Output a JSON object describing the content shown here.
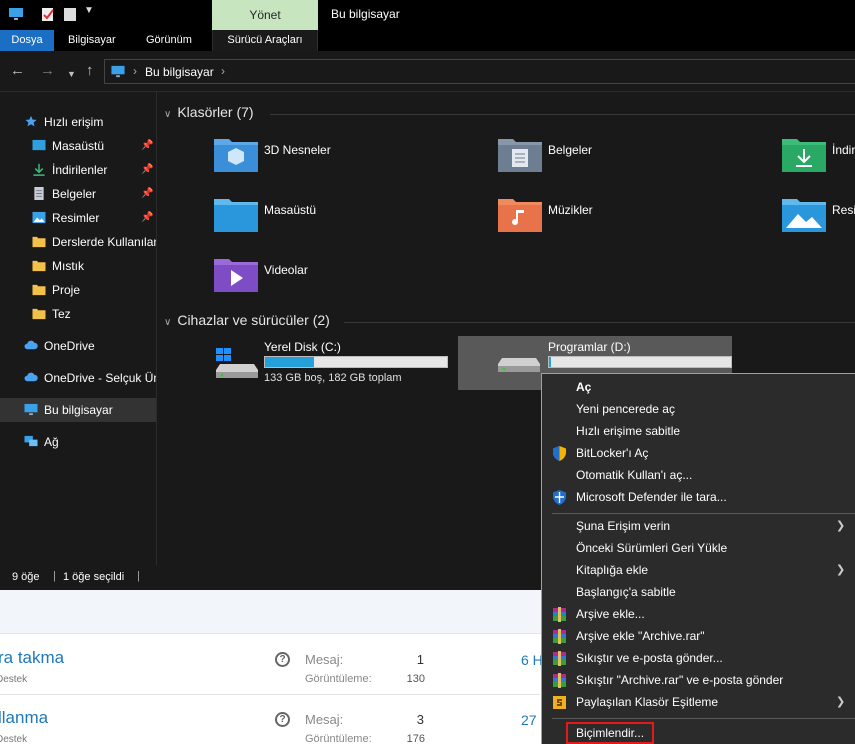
{
  "window": {
    "title": "Bu bilgisayar",
    "context_tab": "Yönet",
    "context_subtab": "Sürücü Araçları"
  },
  "ribbon": {
    "tabs": [
      "Dosya",
      "Bilgisayar",
      "Görünüm"
    ]
  },
  "address": {
    "path": "Bu bilgisayar",
    "icon": "computer-icon"
  },
  "sidebar": {
    "items": [
      {
        "label": "Hızlı erişim",
        "icon": "star-icon",
        "pinned": false
      },
      {
        "label": "Masaüstü",
        "icon": "desktop-folder-icon",
        "pinned": true
      },
      {
        "label": "İndirilenler",
        "icon": "download-icon",
        "pinned": true
      },
      {
        "label": "Belgeler",
        "icon": "documents-icon",
        "pinned": true
      },
      {
        "label": "Resimler",
        "icon": "pictures-icon",
        "pinned": true
      },
      {
        "label": "Derslerde Kullanılan",
        "icon": "folder-icon",
        "pinned": false
      },
      {
        "label": "Mıstık",
        "icon": "folder-icon",
        "pinned": false
      },
      {
        "label": "Proje",
        "icon": "folder-icon",
        "pinned": false
      },
      {
        "label": "Tez",
        "icon": "folder-icon",
        "pinned": false
      },
      {
        "label": "OneDrive",
        "icon": "cloud-icon",
        "pinned": false
      },
      {
        "label": "OneDrive - Selçuk Ün",
        "icon": "cloud-icon",
        "pinned": false
      },
      {
        "label": "Bu bilgisayar",
        "icon": "computer-icon",
        "pinned": false,
        "selected": true
      },
      {
        "label": "Ağ",
        "icon": "network-icon",
        "pinned": false
      }
    ]
  },
  "content": {
    "folders_header": "Klasörler (7)",
    "folders": [
      {
        "label": "3D Nesneler",
        "icon": "3d-objects-icon"
      },
      {
        "label": "Belgeler",
        "icon": "documents-folder-icon"
      },
      {
        "label": "İndir",
        "icon": "downloads-folder-icon"
      },
      {
        "label": "Masaüstü",
        "icon": "desktop-folder-icon"
      },
      {
        "label": "Müzikler",
        "icon": "music-folder-icon"
      },
      {
        "label": "Resir",
        "icon": "pictures-folder-icon"
      },
      {
        "label": "Videolar",
        "icon": "videos-folder-icon"
      }
    ],
    "drives_header": "Cihazlar ve sürücüler (2)",
    "drives": [
      {
        "name": "Yerel Disk (C:)",
        "size_text": "133 GB boş, 182 GB toplam",
        "used_fraction": 0.27,
        "icon": "windows-drive-icon"
      },
      {
        "name": "Programlar (D:)",
        "size_text": "",
        "used_fraction": 0.01,
        "icon": "drive-icon",
        "selected": true
      }
    ]
  },
  "status": {
    "count": "9 öğe",
    "selected": "1 öğe seçildi"
  },
  "webpage": {
    "rows": [
      {
        "title": "ra takma",
        "sub": "Destek",
        "msg_label": "Mesaj:",
        "msg": "1",
        "view_label": "Görüntüleme:",
        "views": "130",
        "extra": "6 H"
      },
      {
        "title": "llanma",
        "sub": "Destek",
        "msg_label": "Mesaj:",
        "msg": "3",
        "view_label": "Görüntüleme:",
        "views": "176",
        "extra": "27"
      }
    ]
  },
  "context_menu": {
    "items": [
      {
        "label": "Aç",
        "bold": true
      },
      {
        "label": "Yeni pencerede aç"
      },
      {
        "label": "Hızlı erişime sabitle"
      },
      {
        "label": "BitLocker'ı Aç",
        "icon": "shield-icon"
      },
      {
        "label": "Otomatik Kullan'ı aç..."
      },
      {
        "label": "Microsoft Defender ile tara...",
        "icon": "defender-icon"
      },
      {
        "separator": true
      },
      {
        "label": "Şuna Erişim verin",
        "submenu": true
      },
      {
        "label": "Önceki Sürümleri Geri Yükle"
      },
      {
        "label": "Kitaplığa ekle",
        "submenu": true
      },
      {
        "label": "Başlangıç'a sabitle"
      },
      {
        "label": "Arşive ekle...",
        "icon": "winrar-icon"
      },
      {
        "label": "Arşive ekle \"Archive.rar\"",
        "icon": "winrar-icon"
      },
      {
        "label": "Sıkıştır ve e-posta gönder...",
        "icon": "winrar-icon"
      },
      {
        "label": "Sıkıştır \"Archive.rar\" ve e-posta gönder",
        "icon": "winrar-icon"
      },
      {
        "label": "Paylaşılan Klasör Eşitleme",
        "icon": "sync-icon",
        "submenu": true
      },
      {
        "separator": true
      },
      {
        "label": "Biçimlendir...",
        "highlighted": true
      }
    ]
  },
  "colors": {
    "accent": "#1a6fc4",
    "context_tab": "#c7e6c0",
    "drive_fill": "#26a0da",
    "highlight_box": "#e21a1a",
    "link": "#1e78b9"
  }
}
